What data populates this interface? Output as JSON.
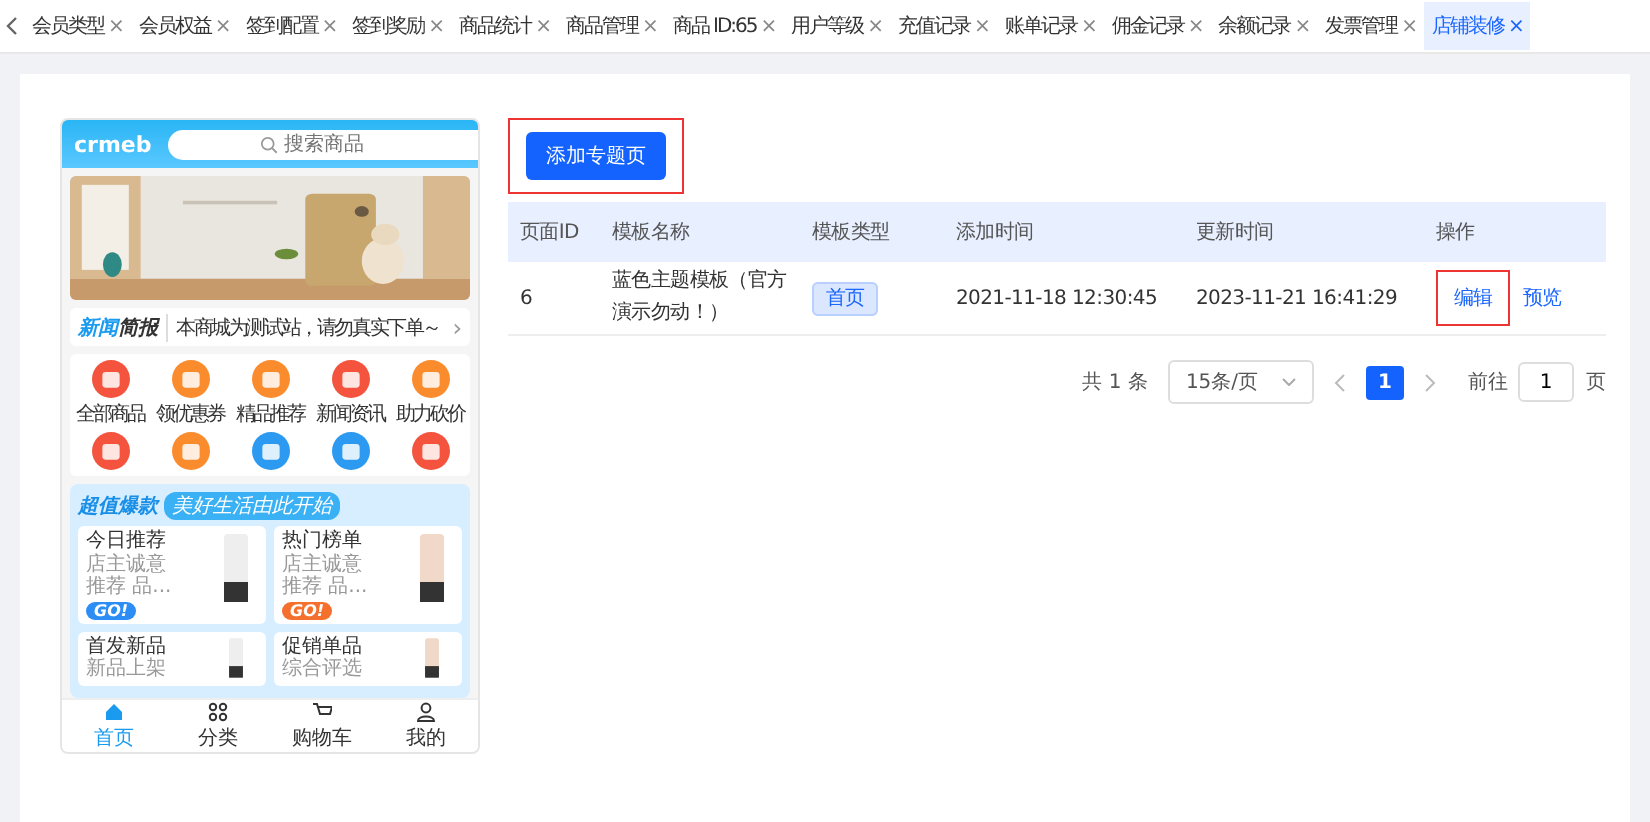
{
  "tabs": [
    {
      "label": "会员类型",
      "selected": false
    },
    {
      "label": "会员权益",
      "selected": false
    },
    {
      "label": "签到配置",
      "selected": false
    },
    {
      "label": "签到奖励",
      "selected": false
    },
    {
      "label": "商品统计",
      "selected": false
    },
    {
      "label": "商品管理",
      "selected": false
    },
    {
      "label": "商品 ID:65",
      "selected": false
    },
    {
      "label": "用户等级",
      "selected": false
    },
    {
      "label": "充值记录",
      "selected": false
    },
    {
      "label": "账单记录",
      "selected": false
    },
    {
      "label": "佣金记录",
      "selected": false
    },
    {
      "label": "余额记录",
      "selected": false
    },
    {
      "label": "发票管理",
      "selected": false
    },
    {
      "label": "店铺装修",
      "selected": true
    }
  ],
  "close_glyph": "×",
  "phone": {
    "logo": "crmeb",
    "search": {
      "placeholder": "搜索商品"
    },
    "notice": {
      "title_a": "新闻",
      "title_b": "简报",
      "text": "本商城为测试站，请勿真实下单～",
      "arrow": "›"
    },
    "categories": [
      {
        "label": "全部商品",
        "color": "#f4533d"
      },
      {
        "label": "领优惠券",
        "color": "#fb8c2e"
      },
      {
        "label": "精品推荐",
        "color": "#fb8c2e"
      },
      {
        "label": "新闻资讯",
        "color": "#f4533d"
      },
      {
        "label": "助力砍价",
        "color": "#fb8c2e"
      },
      {
        "color": "#f4533d"
      },
      {
        "color": "#fb8c2e"
      },
      {
        "color": "#2c9af0"
      },
      {
        "color": "#2c9af0"
      },
      {
        "color": "#f4533d"
      }
    ],
    "promo": {
      "title": "超值爆款",
      "slogan": "美好生活由此开始",
      "cards": [
        {
          "title": "今日推荐",
          "lines": [
            "店主诚意",
            "推荐 品..."
          ],
          "badge": {
            "label": "GO!",
            "color": "#2c8ef5"
          }
        },
        {
          "title": "热门榜单",
          "lines": [
            "店主诚意",
            "推荐 品..."
          ],
          "badge": {
            "label": "GO!",
            "color": "#f5702c"
          }
        },
        {
          "title": "首发新品",
          "lines": [
            "新品上架"
          ]
        },
        {
          "title": "促销单品",
          "lines": [
            "综合评选"
          ]
        }
      ]
    },
    "nav": [
      {
        "label": "首页",
        "selected": true
      },
      {
        "label": "分类",
        "selected": false
      },
      {
        "label": "购物车",
        "selected": false
      },
      {
        "label": "我的",
        "selected": false
      }
    ]
  },
  "add_button": {
    "label": "添加专题页",
    "highlighted": true
  },
  "table": {
    "columns": [
      "页面ID",
      "模板名称",
      "模板类型",
      "添加时间",
      "更新时间",
      "操作"
    ],
    "rows": [
      {
        "id": "6",
        "name": "蓝色主题模板（官方演示勿动！）",
        "type": "首页",
        "added": "2021-11-18 12:30:45",
        "updated": "2023-11-21 16:41:29",
        "actions": [
          {
            "label": "编辑",
            "highlighted": true
          },
          {
            "label": "预览",
            "highlighted": false
          }
        ]
      }
    ]
  },
  "pagination": {
    "total": "共 1 条",
    "page_size": "15条/页",
    "pages": [
      {
        "label": "1",
        "selected": true
      }
    ],
    "goto_label": "前往",
    "goto_value": "1",
    "goto_unit": "页"
  }
}
